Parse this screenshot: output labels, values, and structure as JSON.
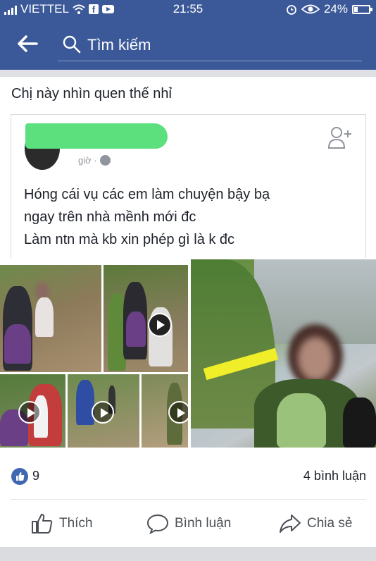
{
  "status_bar": {
    "carrier": "VIETTEL",
    "time": "21:55",
    "battery": "24%"
  },
  "search": {
    "placeholder": "Tìm kiếm"
  },
  "post": {
    "caption": "Chị này nhìn quen thế nhỉ",
    "shared": {
      "time_partial": "giờ ·",
      "text_lines": [
        "Hóng cái vụ các em làm chuyện bậy bạ",
        "ngay trên nhà mềnh mới đc",
        "Làm ntn mà kb xin phép gì là k đc"
      ]
    },
    "like_count": "9",
    "comment_count": "4 bình luận"
  },
  "actions": {
    "like": "Thích",
    "comment": "Bình luận",
    "share": "Chia sẻ"
  },
  "colors": {
    "facebook_blue": "#3b5998",
    "like_blue": "#4267b2",
    "redaction_green": "#5be07d"
  }
}
